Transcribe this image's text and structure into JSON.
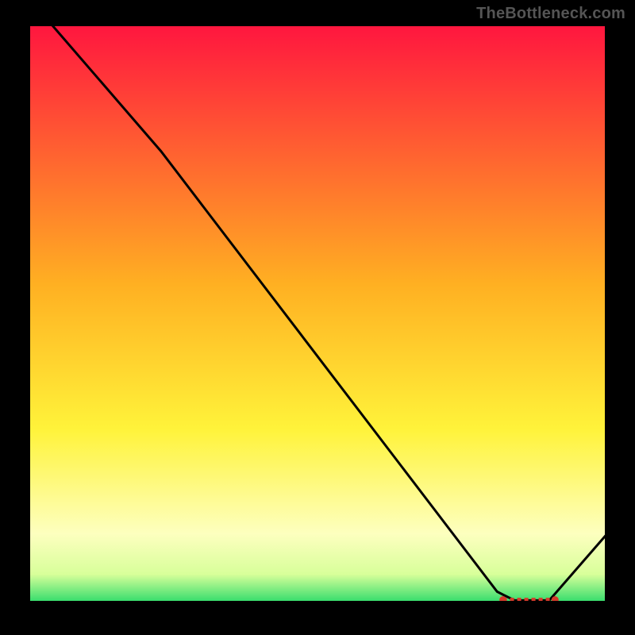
{
  "watermark": "TheBottleneck.com",
  "colors": {
    "background_black": "#000000",
    "gradient_top": "#ff153f",
    "gradient_mid_orange": "#ffb022",
    "gradient_yellow": "#fff33a",
    "gradient_pale": "#fdffbf",
    "gradient_green": "#2cdb6a",
    "line": "#000000",
    "marker": "#d43a2a"
  },
  "chart_data": {
    "type": "line",
    "title": "",
    "xlabel": "",
    "ylabel": "",
    "xlim": [
      0,
      100
    ],
    "ylim": [
      0,
      100
    ],
    "series": [
      {
        "name": "bottleneck-curve",
        "x": [
          4,
          23,
          81,
          84,
          90,
          100
        ],
        "y": [
          100,
          78,
          2,
          0.5,
          0.5,
          12
        ]
      }
    ],
    "flat_segment": {
      "x_start": 82,
      "x_end": 91,
      "y": 0.6,
      "label": ""
    },
    "gradient_stops_pct": [
      0,
      45,
      70,
      88,
      95,
      100
    ]
  }
}
